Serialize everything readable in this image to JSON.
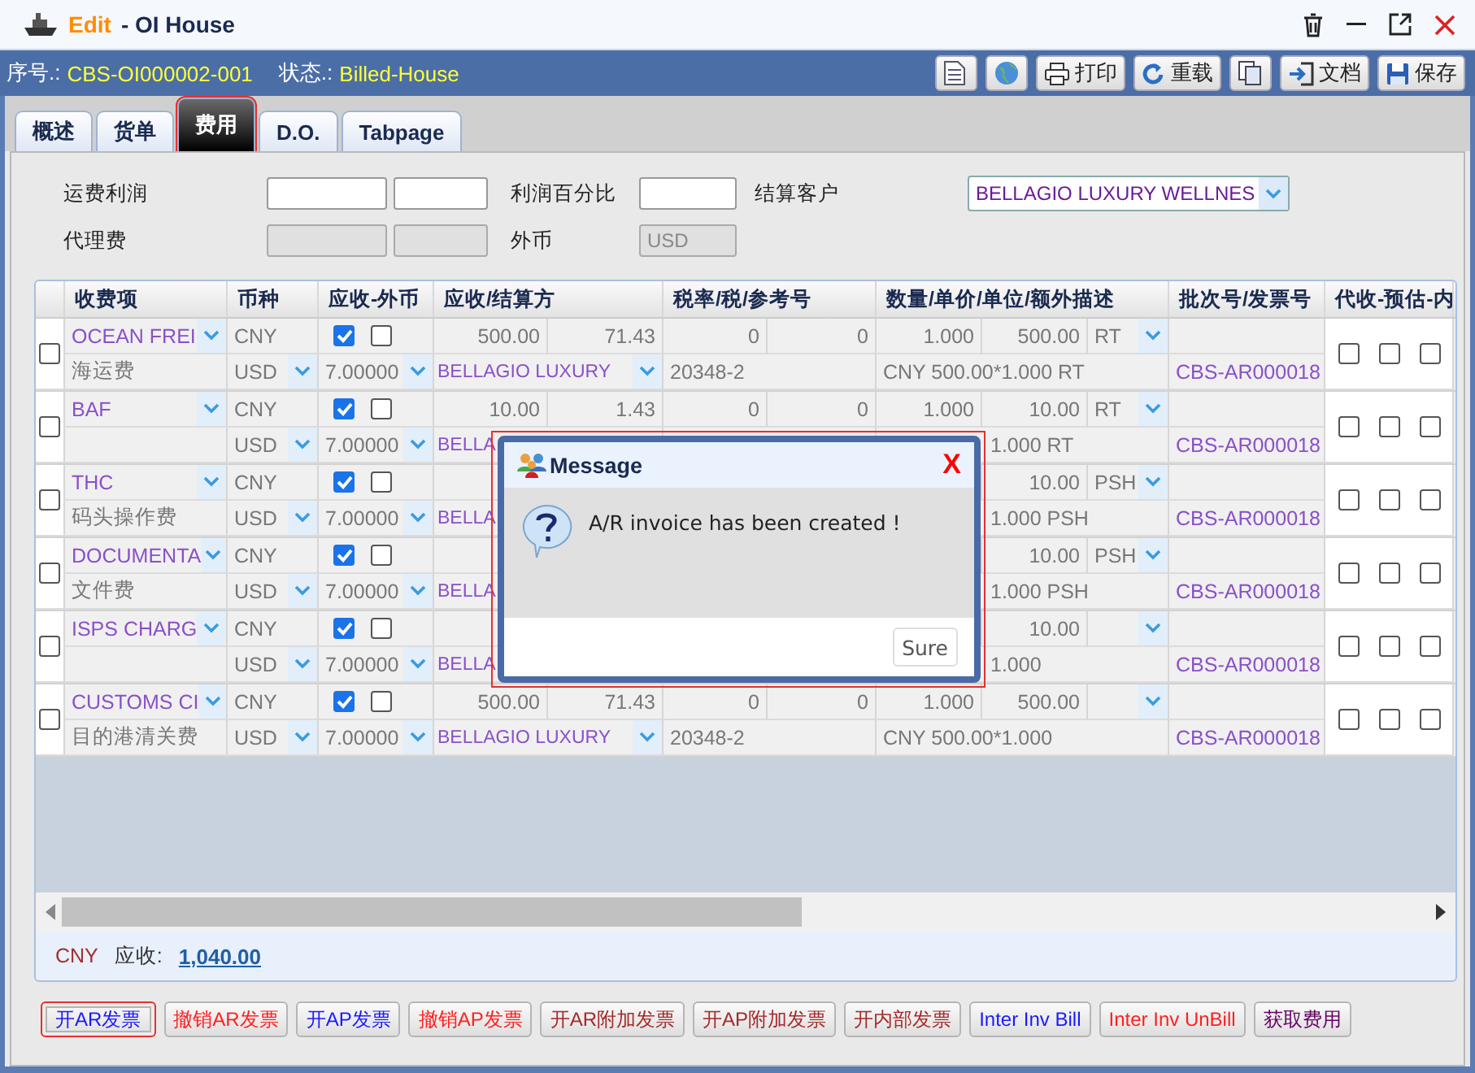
{
  "window": {
    "mode": "Edit",
    "title": "- OI House"
  },
  "info": {
    "no_label": "序号.:",
    "no": "CBS-OI000002-001",
    "status_label": "状态.:",
    "status": "Billed-House"
  },
  "toolbar": [
    {
      "kind": "doc"
    },
    {
      "kind": "globe"
    },
    {
      "kind": "print",
      "label": "打印"
    },
    {
      "kind": "reload",
      "label": "重载"
    },
    {
      "kind": "copy"
    },
    {
      "kind": "import",
      "label": "文档"
    },
    {
      "kind": "save",
      "label": "保存"
    }
  ],
  "tabs": [
    {
      "label": "概述",
      "selected": false
    },
    {
      "label": "货单",
      "selected": false
    },
    {
      "label": "费用",
      "selected": true
    },
    {
      "label": "D.O.",
      "selected": false
    },
    {
      "label": "Tabpage",
      "selected": false
    }
  ],
  "form": {
    "profit_label": "运费利润",
    "percent_label": "利润百分比",
    "customer_label": "结算客户",
    "customer": "BELLAGIO LUXURY WELLNES",
    "agency_label": "代理费",
    "currency_label": "外币",
    "currency": "USD"
  },
  "table": {
    "columns": [
      "收费项",
      "币种",
      "应收-外币",
      "应收/结算方",
      "税率/税/参考号",
      "数量/单价/单位/额外描述",
      "批次号/发票号",
      "代收-预估-内"
    ],
    "records": [
      {
        "selected": false,
        "item": "OCEAN FREI",
        "item_cn": "海运费",
        "cur": "CNY",
        "cur2": "USD",
        "rate": "7.00000",
        "ar_checked": true,
        "fx_checked": false,
        "amount": "500.00",
        "amount2": "71.43",
        "party": "BELLAGIO LUXURY",
        "tax": "0",
        "tax2": "0",
        "ref": "20348-2",
        "qty": "1.000",
        "price": "500.00",
        "unit": "RT",
        "desc": "CNY 500.00*1.000 RT",
        "covered": false,
        "invoice": "CBS-AR000018",
        "flags": [
          false,
          false,
          false
        ]
      },
      {
        "selected": false,
        "item": "BAF",
        "cur": "CNY",
        "cur2": "USD",
        "rate": "7.00000",
        "ar_checked": true,
        "fx_checked": false,
        "amount": "10.00",
        "amount2": "1.43",
        "party": "BELLA",
        "tax": "0",
        "tax2": "0",
        "qty": "1.000",
        "price": "10.00",
        "unit": "RT",
        "desc": "1.000 RT",
        "covered": true,
        "invoice": "CBS-AR000018",
        "flags": [
          false,
          false,
          false
        ]
      },
      {
        "selected": false,
        "item": "THC",
        "item_cn": "码头操作费",
        "cur": "CNY",
        "cur2": "USD",
        "rate": "7.00000",
        "ar_checked": true,
        "fx_checked": false,
        "party": "BELLA",
        "price": "10.00",
        "unit": "PSH",
        "desc": "1.000 PSH",
        "covered": true,
        "invoice": "CBS-AR000018",
        "flags": [
          false,
          false,
          false
        ]
      },
      {
        "selected": false,
        "item": "DOCUMENTA",
        "item_cn": "文件费",
        "cur": "CNY",
        "cur2": "USD",
        "rate": "7.00000",
        "ar_checked": true,
        "fx_checked": false,
        "party": "BELLA",
        "price": "10.00",
        "unit": "PSH",
        "desc": "1.000 PSH",
        "covered": true,
        "invoice": "CBS-AR000018",
        "flags": [
          false,
          false,
          false
        ]
      },
      {
        "selected": false,
        "item": "ISPS CHARG",
        "cur": "CNY",
        "cur2": "USD",
        "rate": "7.00000",
        "ar_checked": true,
        "fx_checked": false,
        "party": "BELLA",
        "price": "10.00",
        "desc": "1.000",
        "covered": true,
        "invoice": "CBS-AR000018",
        "flags": [
          false,
          false,
          false
        ]
      },
      {
        "selected": false,
        "item": "CUSTOMS CI",
        "item_cn": "目的港清关费",
        "cur": "CNY",
        "cur2": "USD",
        "rate": "7.00000",
        "ar_checked": true,
        "fx_checked": false,
        "amount": "500.00",
        "amount2": "71.43",
        "party": "BELLAGIO LUXURY",
        "tax": "0",
        "tax2": "0",
        "ref": "20348-2",
        "qty": "1.000",
        "price": "500.00",
        "desc": "CNY 500.00*1.000",
        "covered": false,
        "invoice": "CBS-AR000018",
        "flags": [
          false,
          false,
          false
        ]
      }
    ]
  },
  "summary": {
    "currency": "CNY",
    "label": "应收:",
    "total": "1,040.00"
  },
  "buttons": [
    {
      "label": "开AR发票",
      "color": "#1a1aff",
      "focused": true
    },
    {
      "label": "撤销AR发票",
      "color": "#ff2020",
      "focused": false
    },
    {
      "label": "开AP发票",
      "color": "#1a1aff",
      "focused": false
    },
    {
      "label": "撤销AP发票",
      "color": "#ff2020",
      "focused": false
    },
    {
      "label": "开AR附加发票",
      "color": "#a52a2a",
      "focused": false
    },
    {
      "label": "开AP附加发票",
      "color": "#a52a2a",
      "focused": false
    },
    {
      "label": "开内部发票",
      "color": "#a52a2a",
      "focused": false
    },
    {
      "label": "Inter Inv Bill",
      "color": "#1a1aff",
      "focused": false
    },
    {
      "label": "Inter Inv UnBill",
      "color": "#ff2020",
      "focused": false
    },
    {
      "label": "获取费用",
      "color": "#660066",
      "focused": false
    }
  ],
  "dialog": {
    "title": "Message",
    "close": "X",
    "message": "A/R invoice has been created !",
    "button": "Sure"
  }
}
